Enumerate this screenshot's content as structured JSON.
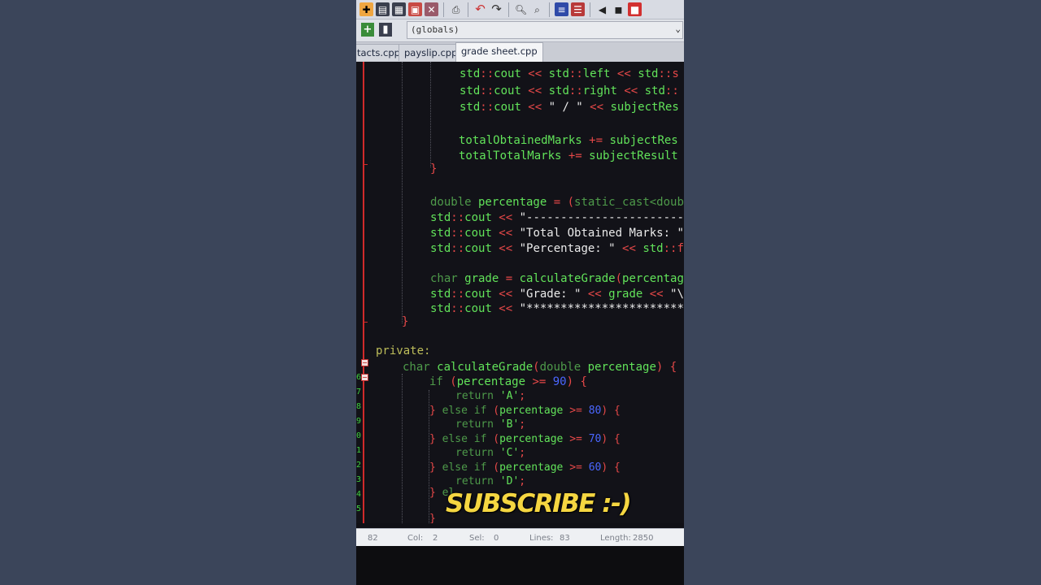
{
  "toolbar": {
    "icons": [
      "new-file-icon",
      "open-icon",
      "save-icon",
      "save-all-icon",
      "close-icon",
      "print-icon",
      "undo-icon",
      "redo-icon",
      "find-icon",
      "replace-icon",
      "indent-icon",
      "unindent-icon",
      "bookmark-icon",
      "goto-icon",
      "stop-icon"
    ]
  },
  "scope": {
    "value": "(globals)"
  },
  "tabs": [
    {
      "label": "tacts.cpp"
    },
    {
      "label": "payslip.cpp"
    },
    {
      "label": "grade sheet.cpp",
      "active": true
    }
  ],
  "gutter": {
    "numbers": [
      "6",
      "7",
      "8",
      "9",
      "0",
      "1",
      "2",
      "3",
      "4",
      "5"
    ]
  },
  "overlay": {
    "text": "SUBSCRIBE :-)"
  },
  "status": {
    "line_value": "82",
    "col_label": "Col:",
    "col_value": "2",
    "sel_label": "Sel:",
    "sel_value": "0",
    "lines_label": "Lines:",
    "lines_value": "83",
    "length_label": "Length:",
    "length_value": "2850"
  },
  "code": {
    "l1": {
      "p1": "std",
      "p2": "::",
      "p3": "cout",
      "p4": " << ",
      "p5": "std",
      "p6": "::",
      "p7": "left",
      "p8": " << ",
      "p9": "std",
      "p10": "::s"
    },
    "l2": {
      "p1": "std",
      "p2": "::",
      "p3": "cout",
      "p4": " << ",
      "p5": "std",
      "p6": "::",
      "p7": "right",
      "p8": " << ",
      "p9": "std",
      "p10": "::"
    },
    "l3": {
      "p1": "std",
      "p2": "::",
      "p3": "cout",
      "p4": " << ",
      "p5": "\" / \"",
      "p6": " << ",
      "p7": "subjectRes"
    },
    "l4": {
      "p1": "totalObtainedMarks",
      "p2": " += ",
      "p3": "subjectRes"
    },
    "l5": {
      "p1": "totalTotalMarks",
      "p2": " += ",
      "p3": "subjectResult"
    },
    "l6": {
      "p1": "}"
    },
    "l7": {
      "p1": "double",
      "p2": " percentage",
      "p3": " = ",
      "p4": "(",
      "p5": "static_cast<doub"
    },
    "l8": {
      "p1": "std",
      "p2": "::",
      "p3": "cout",
      "p4": " << ",
      "p5": "\"-----------------------"
    },
    "l9": {
      "p1": "std",
      "p2": "::",
      "p3": "cout",
      "p4": " << ",
      "p5": "\"Total Obtained Marks: \""
    },
    "l10": {
      "p1": "std",
      "p2": "::",
      "p3": "cout",
      "p4": " << ",
      "p5": "\"Percentage: \"",
      "p6": " << ",
      "p7": "std",
      "p8": "::f"
    },
    "l11": {
      "p1": "char",
      "p2": " grade",
      "p3": " = ",
      "p4": "calculateGrade",
      "p5": "(",
      "p6": "percentage"
    },
    "l12": {
      "p1": "std",
      "p2": "::",
      "p3": "cout",
      "p4": " << ",
      "p5": "\"Grade: \"",
      "p6": " << ",
      "p7": "grade",
      "p8": " << ",
      "p9": "\"\\("
    },
    "l13": {
      "p1": "std",
      "p2": "::",
      "p3": "cout",
      "p4": " << ",
      "p5": "\"***********************"
    },
    "l14": {
      "p1": "}"
    },
    "l15": {
      "p1": "private:"
    },
    "l16": {
      "p1": "char",
      "p2": " calculateGrade",
      "p3": "(",
      "p4": "double",
      "p5": " percentage",
      "p6": ")",
      "p7": " {"
    },
    "l17": {
      "p1": "if",
      "p2": " (",
      "p3": "percentage",
      "p4": " >= ",
      "p5": "90",
      "p6": ") {"
    },
    "l18": {
      "p1": "return",
      "p2": " 'A'",
      "p3": ";"
    },
    "l19": {
      "p1": "}",
      "p2": " else if",
      "p3": " (",
      "p4": "percentage",
      "p5": " >= ",
      "p6": "80",
      "p7": ") {"
    },
    "l20": {
      "p1": "return",
      "p2": " 'B'",
      "p3": ";"
    },
    "l21": {
      "p1": "}",
      "p2": " else if",
      "p3": " (",
      "p4": "percentage",
      "p5": " >= ",
      "p6": "70",
      "p7": ") {"
    },
    "l22": {
      "p1": "return",
      "p2": " 'C'",
      "p3": ";"
    },
    "l23": {
      "p1": "}",
      "p2": " else if",
      "p3": " (",
      "p4": "percentage",
      "p5": " >= ",
      "p6": "60",
      "p7": ") {"
    },
    "l24": {
      "p1": "return",
      "p2": " 'D'",
      "p3": ";"
    },
    "l25": {
      "p1": "}",
      "p2": " el"
    },
    "l26": {
      "p1": "}"
    }
  }
}
